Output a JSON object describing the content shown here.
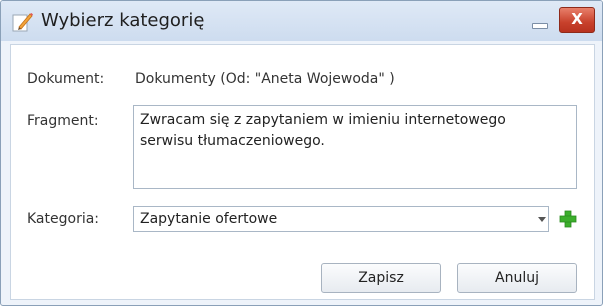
{
  "dialog": {
    "title": "Wybierz kategorię",
    "title_icon": "pencil-edit-icon",
    "minimize_icon": "minimize-icon",
    "close_label": "X"
  },
  "form": {
    "document_label": "Dokument:",
    "document_value": "Dokumenty (Od: \"Aneta Wojewoda\" )",
    "fragment_label": "Fragment:",
    "fragment_value": "Zwracam się z zapytaniem w imieniu internetowego\nserwisu tłumaczeniowego.",
    "category_label": "Kategoria:",
    "category_value": "Zapytanie ofertowe",
    "dropdown_icon": "chevron-down-icon",
    "add_icon": "plus-icon"
  },
  "buttons": {
    "save_label": "Zapisz",
    "cancel_label": "Anuluj"
  },
  "colors": {
    "accent_green": "#3cae2c",
    "close_red": "#c8412c",
    "titlebar": "#d6e3f3"
  }
}
